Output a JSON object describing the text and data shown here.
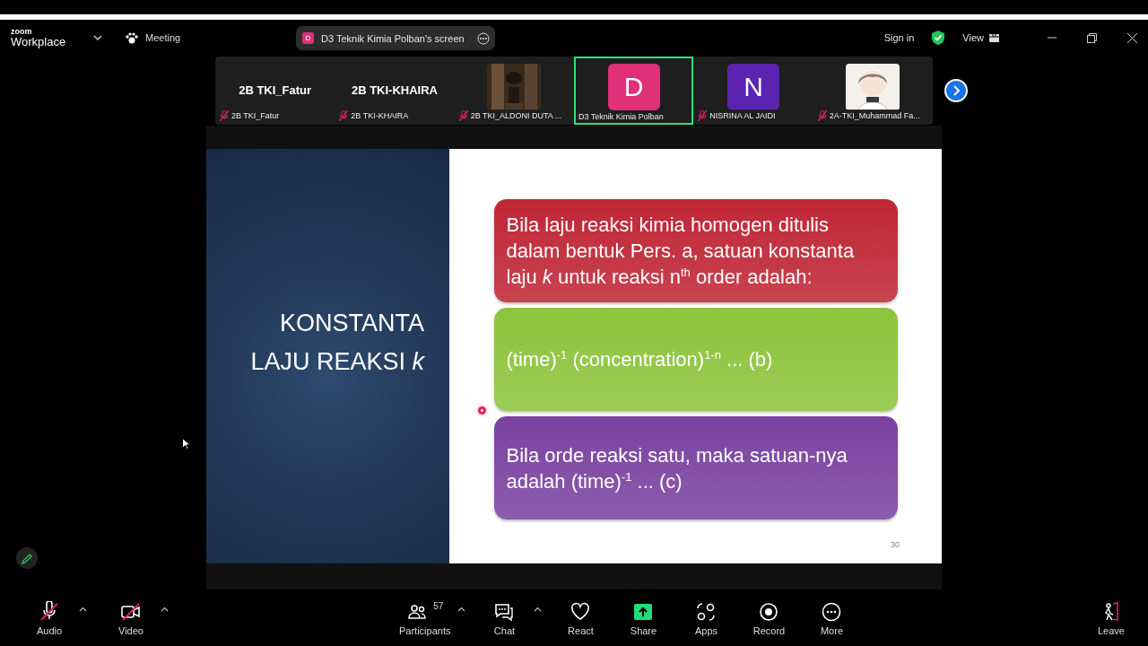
{
  "app": {
    "logo_small": "zoom",
    "logo": "Workplace",
    "meeting_label": "Meeting",
    "share_banner": {
      "letter": "D",
      "text": "D3 Teknik Kimia Polban's screen"
    },
    "sign_in": "Sign in",
    "view": "View"
  },
  "tiles": [
    {
      "kind": "name",
      "heading": "2B TKI_Fatur",
      "label": "2B TKI_Fatur",
      "muted": true,
      "active": false
    },
    {
      "kind": "name",
      "heading": "2B TKI-KHAIRA",
      "label": "2B TKI-KHAIRA",
      "muted": true,
      "active": false
    },
    {
      "kind": "picture",
      "label": "2B TKI_ALDONI DUTA ...",
      "muted": true,
      "active": false
    },
    {
      "kind": "letter",
      "letter": "D",
      "color": "#e0307a",
      "label": "D3 Teknik Kimia Polban",
      "muted": false,
      "active": true
    },
    {
      "kind": "letter",
      "letter": "N",
      "color": "#5b23b0",
      "label": "NISRINA AL JAIDI",
      "muted": true,
      "active": false
    },
    {
      "kind": "picture",
      "label": "2A-TKI_Muhammad Fa...",
      "muted": true,
      "active": false
    }
  ],
  "slide": {
    "title": "KONSTANTA\nLAJU REAKSI *k*",
    "page": "30",
    "boxes": [
      {
        "text": "Bila laju reaksi kimia homogen ditulis dalam bentuk Pers. a, satuan konstanta laju *k* untuk reaksi n$^{th}$ order adalah:",
        "color": "#c02636"
      },
      {
        "text": "(time)$^{-1}$ (concentration)$^{1-n}$ ... (b)",
        "color": "#8cc43c"
      },
      {
        "text": "Bila orde reaksi satu, maka satuan-nya adalah (time)$^{-1}$ ... (c)",
        "color": "#7a43a0"
      }
    ]
  },
  "toolbar": {
    "left": [
      {
        "kind": "audio",
        "label": "Audio",
        "off": true
      },
      {
        "kind": "video",
        "label": "Video",
        "off": true
      }
    ],
    "center": [
      {
        "kind": "participants",
        "label": "Participants",
        "count": "57",
        "caret": true
      },
      {
        "kind": "chat",
        "label": "Chat",
        "caret": true
      },
      {
        "kind": "react",
        "label": "React"
      },
      {
        "kind": "share",
        "label": "Share"
      },
      {
        "kind": "apps",
        "label": "Apps"
      },
      {
        "kind": "record",
        "label": "Record"
      },
      {
        "kind": "more",
        "label": "More"
      }
    ],
    "leave": "Leave"
  }
}
